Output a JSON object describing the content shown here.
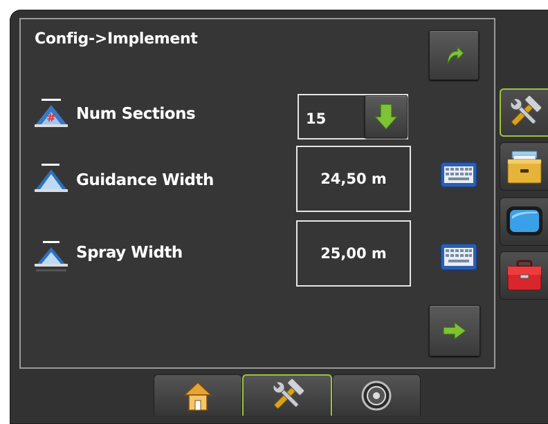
{
  "header": {
    "title": "Config->Implement"
  },
  "rows": {
    "num_sections": {
      "label": "Num Sections",
      "value": "15"
    },
    "guidance_width": {
      "label": "Guidance Width",
      "value": "24,50 m"
    },
    "spray_width": {
      "label": "Spray Width",
      "value": "25,00 m"
    }
  },
  "icons": {
    "back": "return-arrow-icon",
    "next": "next-arrow-icon",
    "dropdown": "green-down-arrow-icon",
    "keyboard": "keyboard-icon",
    "side_tabs": [
      "tools-icon",
      "file-cabinet-icon",
      "screen-icon",
      "toolbox-icon"
    ],
    "bottom_tabs": [
      "home-icon",
      "tools-icon",
      "gauge-icon"
    ]
  },
  "colors": {
    "background": "#323232",
    "panel_border": "#9a9a9a",
    "accent_green": "#7fc236",
    "active_tab_border": "#9fc23a"
  }
}
